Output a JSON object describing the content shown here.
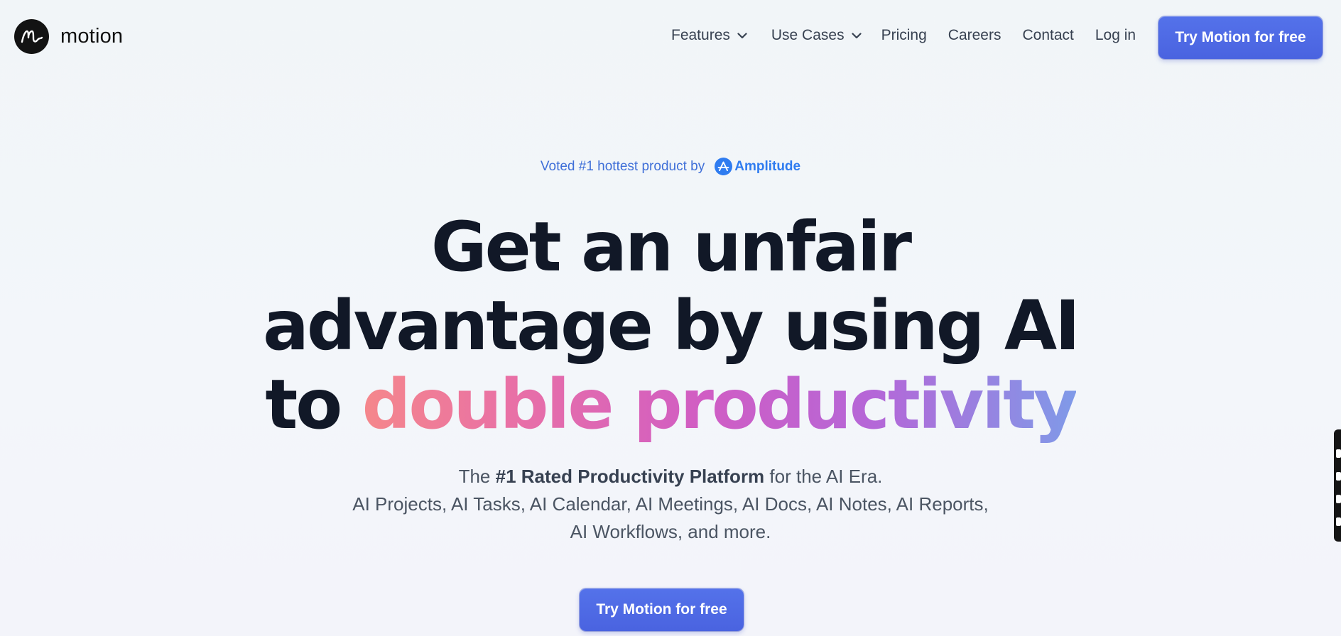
{
  "brand": {
    "name": "motion",
    "logo_icon": "motion-m-icon"
  },
  "nav": {
    "features": "Features",
    "use_cases": "Use Cases",
    "pricing": "Pricing",
    "careers": "Careers",
    "contact": "Contact",
    "login": "Log in",
    "cta": "Try Motion for free"
  },
  "hero": {
    "badge_text": "Voted #1 hottest product by",
    "badge_brand": "Amplitude",
    "headline_line1": "Get an unfair",
    "headline_line2": "advantage by using AI",
    "headline_line3_prefix": "to",
    "headline_line3_highlight": "double productivity",
    "sub_line1_pre": "The",
    "sub_line1_bold": "#1 Rated Productivity Platform",
    "sub_line1_post": "for the AI Era.",
    "sub_line2": "AI Projects, AI Tasks, AI Calendar, AI Meetings, AI Docs, AI Notes, AI Reports,",
    "sub_line3": "AI Workflows, and more.",
    "cta": "Try Motion for free"
  },
  "colors": {
    "cta_bg": "#4a63e0",
    "badge_text": "#3f6fd8",
    "amplitude_blue": "#2f7cf0",
    "headline": "#111827",
    "gradient_start": "#f5878b",
    "gradient_mid": "#d05dc4",
    "gradient_end": "#7f9ae8"
  }
}
